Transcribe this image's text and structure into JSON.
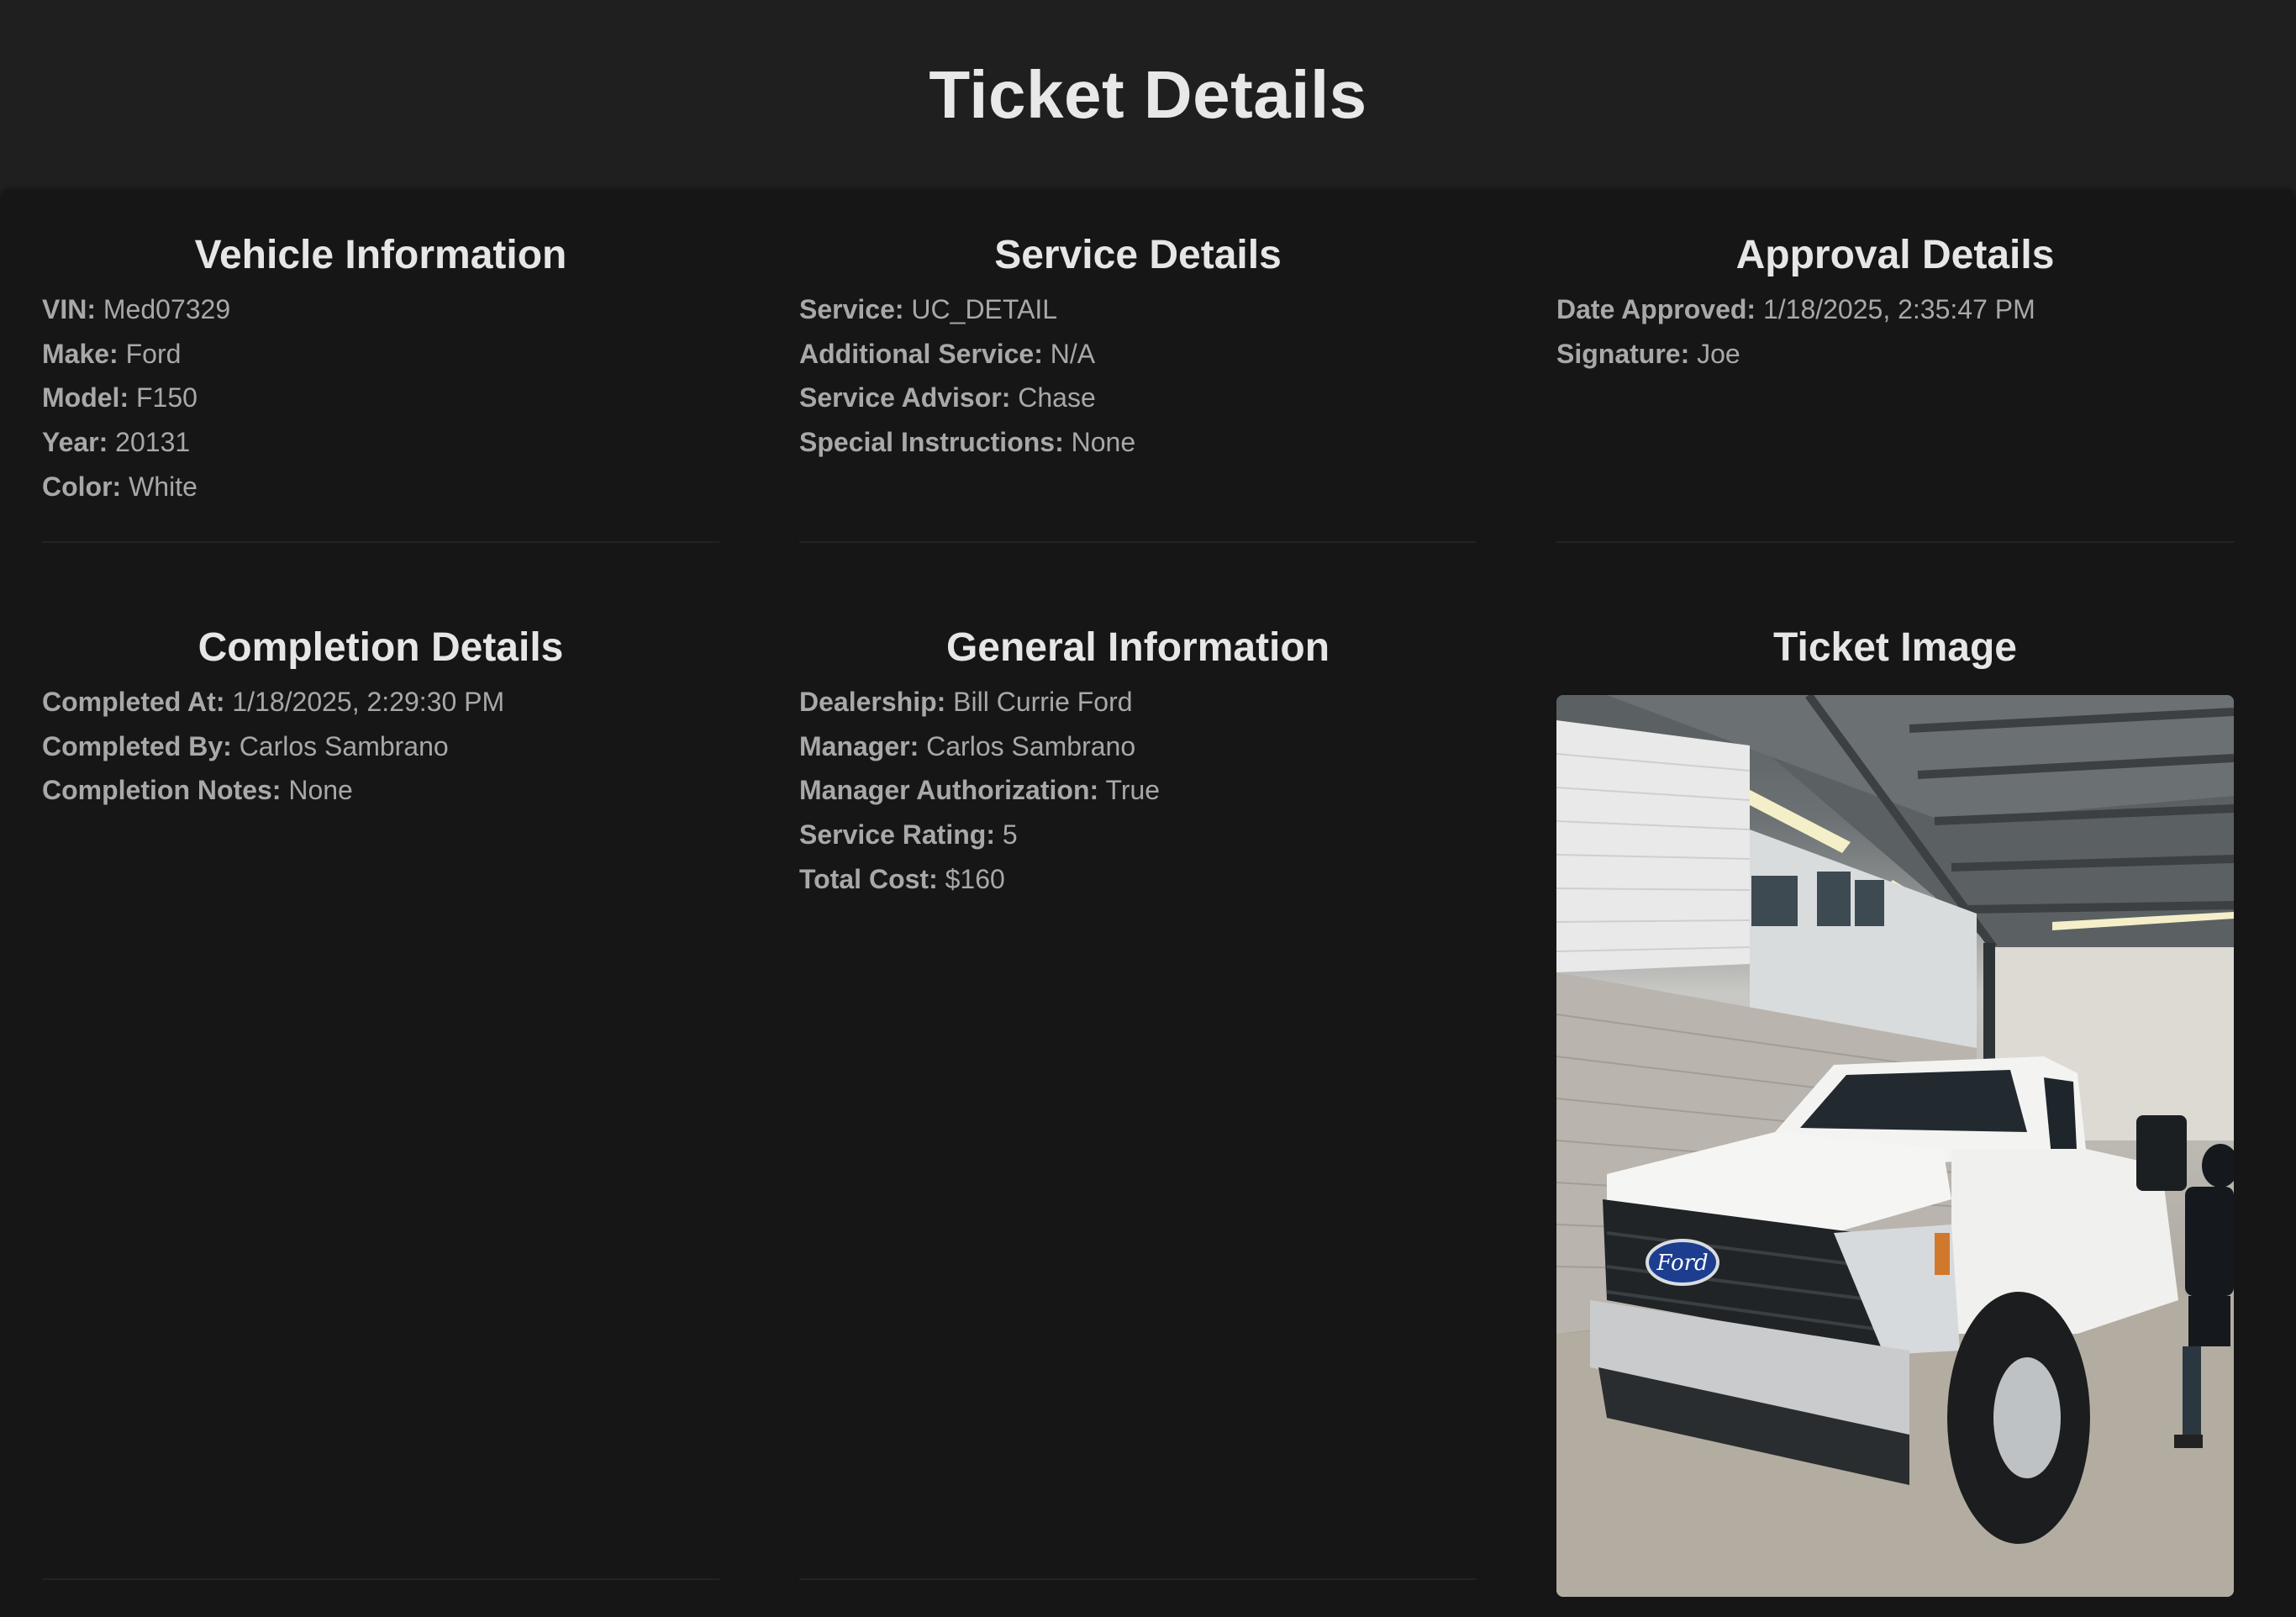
{
  "page": {
    "title": "Ticket Details"
  },
  "vehicle": {
    "heading": "Vehicle Information",
    "fields": [
      {
        "label": "VIN:",
        "value": "Med07329"
      },
      {
        "label": "Make:",
        "value": "Ford"
      },
      {
        "label": "Model:",
        "value": "F150"
      },
      {
        "label": "Year:",
        "value": "20131"
      },
      {
        "label": "Color:",
        "value": "White"
      }
    ]
  },
  "service": {
    "heading": "Service Details",
    "fields": [
      {
        "label": "Service:",
        "value": "UC_DETAIL"
      },
      {
        "label": "Additional Service:",
        "value": "N/A"
      },
      {
        "label": "Service Advisor:",
        "value": "Chase"
      },
      {
        "label": "Special Instructions:",
        "value": "None"
      }
    ]
  },
  "approval": {
    "heading": "Approval Details",
    "fields": [
      {
        "label": "Date Approved:",
        "value": "1/18/2025, 2:35:47 PM"
      },
      {
        "label": "Signature:",
        "value": "Joe"
      }
    ]
  },
  "completion": {
    "heading": "Completion Details",
    "fields": [
      {
        "label": "Completed At:",
        "value": "1/18/2025, 2:29:30 PM"
      },
      {
        "label": "Completed By:",
        "value": "Carlos Sambrano"
      },
      {
        "label": "Completion Notes:",
        "value": "None"
      }
    ]
  },
  "general": {
    "heading": "General Information",
    "fields": [
      {
        "label": "Dealership:",
        "value": "Bill Currie Ford"
      },
      {
        "label": "Manager:",
        "value": "Carlos Sambrano"
      },
      {
        "label": "Manager Authorization:",
        "value": "True"
      },
      {
        "label": "Service Rating:",
        "value": "5"
      },
      {
        "label": "Total Cost:",
        "value": "$160"
      }
    ]
  },
  "ticket_image": {
    "heading": "Ticket Image",
    "badge_text": "Ford"
  },
  "colors": {
    "background": "#1e1e1e",
    "panel": "#161616",
    "heading_text": "#e6e6e6",
    "field_text": "#a8a8a8"
  }
}
